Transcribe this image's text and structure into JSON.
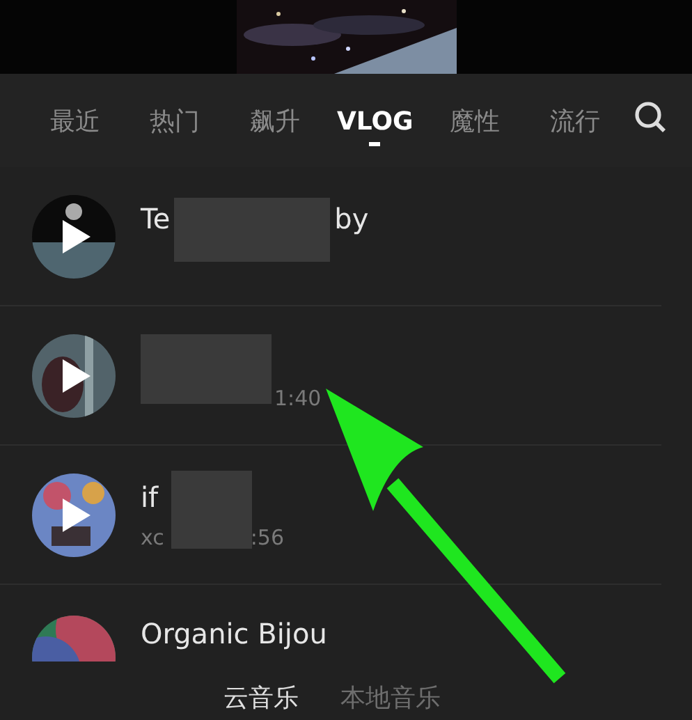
{
  "tabs": [
    {
      "label": "最近",
      "selected": false
    },
    {
      "label": "热门",
      "selected": false
    },
    {
      "label": "飙升",
      "selected": false
    },
    {
      "label": "VLOG",
      "selected": true
    },
    {
      "label": "魔性",
      "selected": false
    },
    {
      "label": "流行",
      "selected": false
    }
  ],
  "tracks": [
    {
      "title_start": "Te",
      "title_end": "by",
      "redacted": true
    },
    {
      "subtitle_end": "1:40",
      "redacted": true
    },
    {
      "title_start": "if",
      "subtitle_start": "xc",
      "subtitle_end": ":56",
      "redacted": true
    },
    {
      "title_start": "Organic Bijou",
      "redacted": false
    }
  ],
  "bottom_tabs": [
    {
      "label": "云音乐",
      "selected": true
    },
    {
      "label": "本地音乐",
      "selected": false
    }
  ],
  "annotation": {
    "kind": "arrow"
  }
}
